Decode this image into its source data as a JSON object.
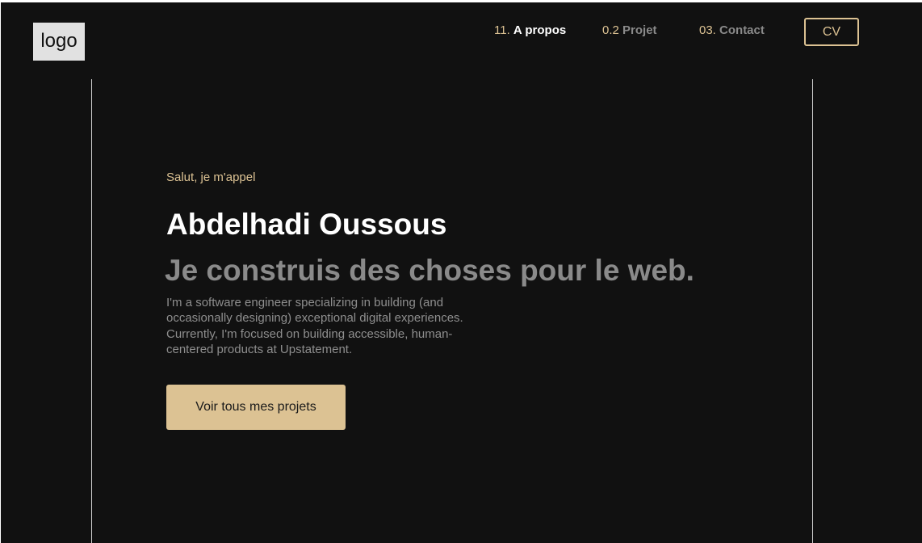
{
  "header": {
    "logo_text": "logo",
    "nav": [
      {
        "number": "11.",
        "label": "A propos",
        "active": true
      },
      {
        "number": "0.2",
        "label": "Projet",
        "active": false
      },
      {
        "number": "03.",
        "label": "Contact",
        "active": false
      }
    ],
    "cv_label": "CV"
  },
  "hero": {
    "greeting": "Salut, je m'appel",
    "name": "Abdelhadi Oussous",
    "tagline": "Je construis des choses pour le web.",
    "bio_lines": [
      "I'm a software engineer specializing in building (and",
      "occasionally designing) exceptional digital experiences.",
      "Currently, I'm focused on building accessible, human-",
      "centered products at Upstatement."
    ],
    "cta_label": "Voir tous mes projets"
  },
  "colors": {
    "background": "#111111",
    "accent": "#dcc293",
    "heading": "#ffffff",
    "muted": "#8a8a8a",
    "logo_bg": "#e1e1e1"
  }
}
